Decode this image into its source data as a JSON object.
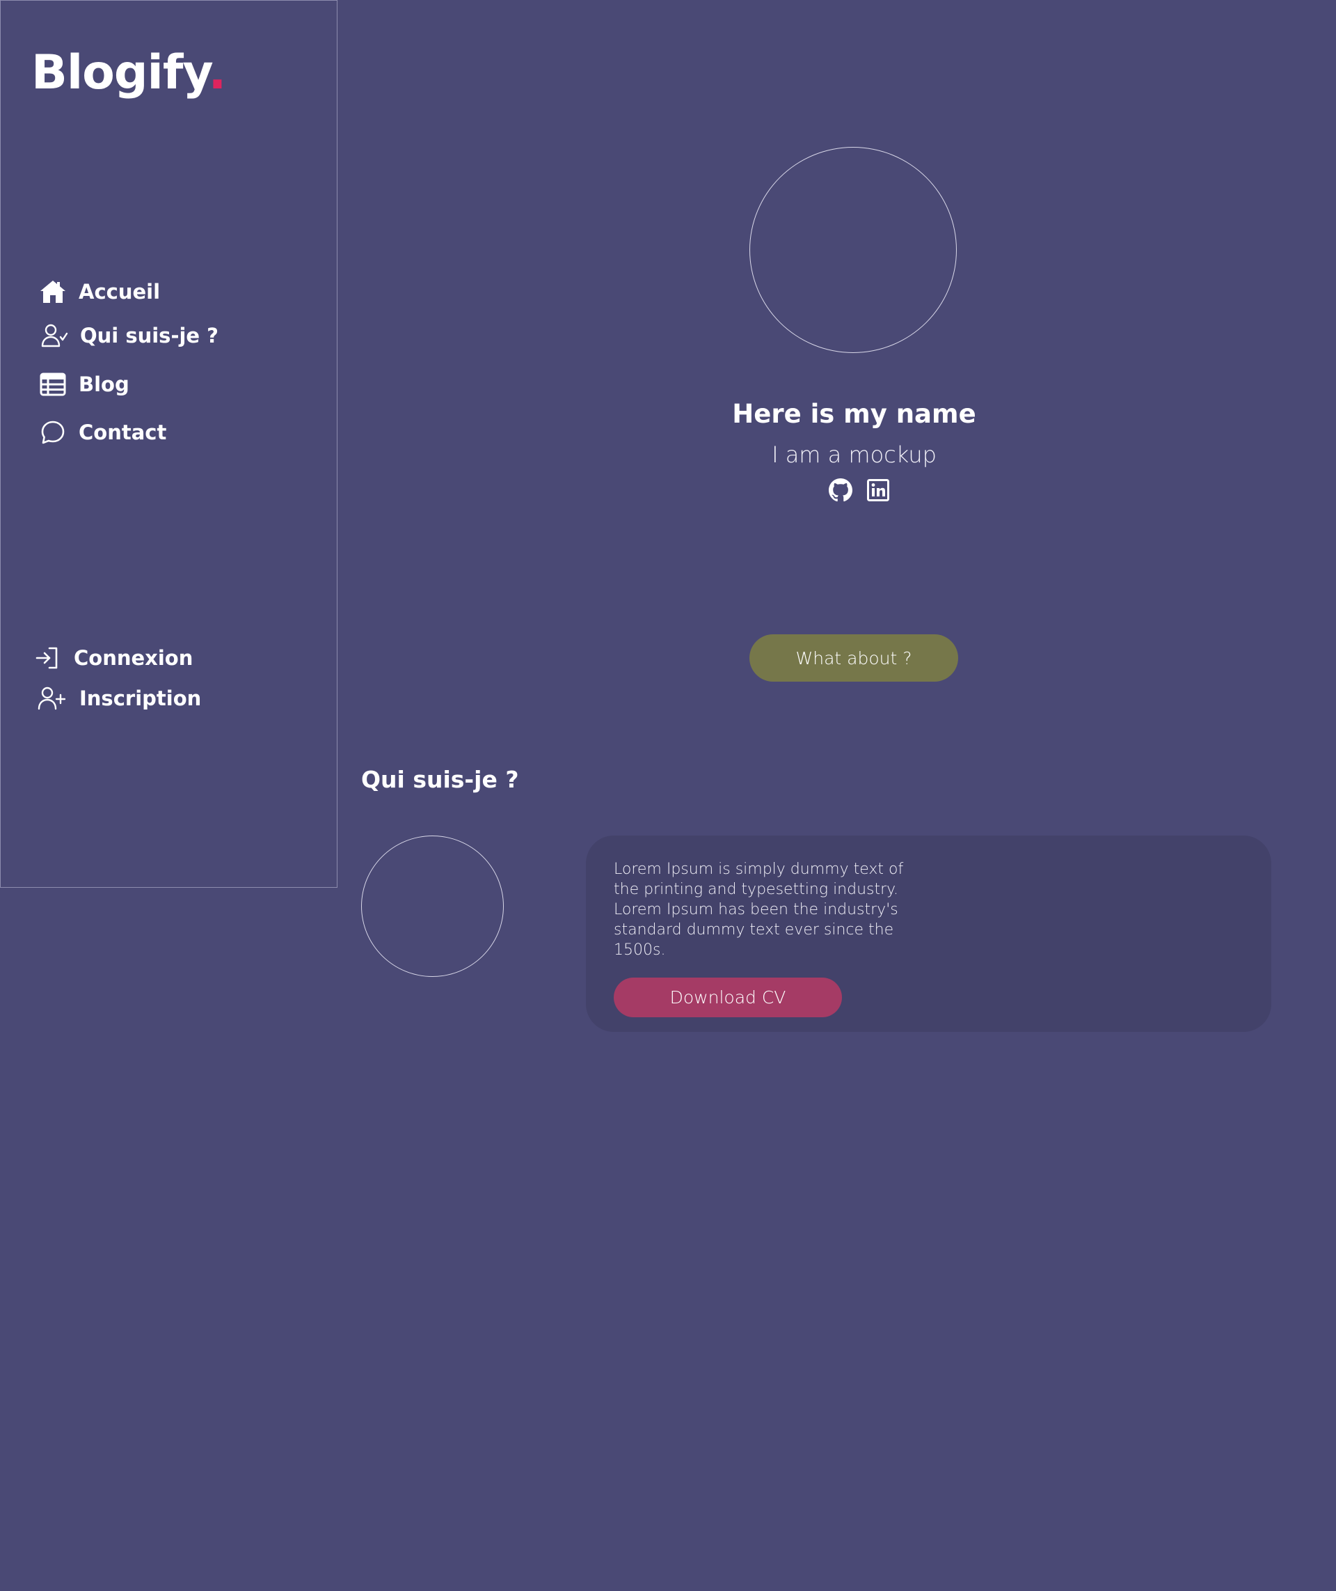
{
  "sidebar": {
    "logo": {
      "text": "Blogify",
      "dot": "."
    },
    "nav": [
      {
        "label": "Accueil",
        "icon": "home-icon"
      },
      {
        "label": "Qui suis-je ?",
        "icon": "user-check-icon"
      },
      {
        "label": "Blog",
        "icon": "table-list-icon"
      },
      {
        "label": "Contact",
        "icon": "chat-bubble-icon"
      }
    ],
    "auth": [
      {
        "label": "Connexion",
        "icon": "login-icon"
      },
      {
        "label": "Inscription",
        "icon": "user-plus-icon"
      }
    ]
  },
  "hero": {
    "name": "Here is my name",
    "subtitle": "I am a mockup",
    "socials": [
      {
        "icon": "github-icon"
      },
      {
        "icon": "linkedin-icon"
      }
    ],
    "cta_label": "What about ?"
  },
  "about": {
    "title": "Qui suis-je ?",
    "text": "Lorem Ipsum is simply dummy text of the printing and typesetting industry. Lorem Ipsum has been the industry's standard dummy text ever since the 1500s.",
    "cv_label": "Download CV"
  },
  "colors": {
    "background": "#4a4975",
    "card": "#43426a",
    "accent_dot": "#e0245e",
    "what_button": "#76774a",
    "cv_button": "#a53b65"
  }
}
